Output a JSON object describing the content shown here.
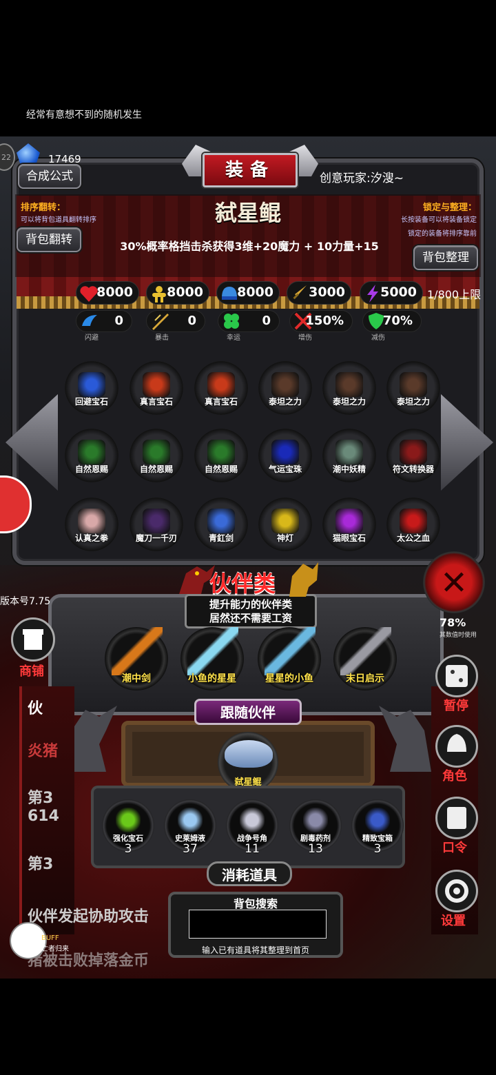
{
  "top_hint": "经常有意想不到的随机发生",
  "header": {
    "level_badge": "22",
    "gem_count": "17469",
    "title": "装备",
    "formula_button": "合成公式",
    "player_name": "创意玩家:汐溲~"
  },
  "sort_flip": {
    "title": "排序翻转：",
    "desc": "可以将背包道具翻转排序",
    "button": "背包翻转"
  },
  "lock_sort": {
    "title": "锁定与整理：",
    "desc1": "长按装备可以将装备锁定",
    "desc2": "锁定的装备将排序靠前",
    "button": "背包整理"
  },
  "selected_item": {
    "name": "弑星鲲",
    "desc": "30%概率格挡击杀获得3维+20魔力 + 10力量+15"
  },
  "stats": {
    "hp": "8000",
    "str": "8000",
    "def": "8000",
    "atk": "3000",
    "magic": "5000",
    "cap": "1/800上限"
  },
  "sub_stats": [
    {
      "label": "闪避",
      "value": "0",
      "icon": "wing-icon"
    },
    {
      "label": "暴击",
      "value": "0",
      "icon": "sword-slash-icon"
    },
    {
      "label": "幸运",
      "value": "0",
      "icon": "clover-icon"
    },
    {
      "label": "增伤",
      "value": "150%",
      "icon": "crossed-swords-icon"
    },
    {
      "label": "减伤",
      "value": "70%",
      "icon": "shield-icon"
    }
  ],
  "items": [
    {
      "name": "回避宝石",
      "color": "#2a5ad8"
    },
    {
      "name": "真言宝石",
      "color": "#c83a1a"
    },
    {
      "name": "真言宝石",
      "color": "#c83a1a"
    },
    {
      "name": "泰坦之力",
      "color": "#5a3a2a"
    },
    {
      "name": "泰坦之力",
      "color": "#5a3a2a"
    },
    {
      "name": "泰坦之力",
      "color": "#5a3a2a"
    },
    {
      "name": "自然恩赐",
      "color": "#2a7a2a"
    },
    {
      "name": "自然恩赐",
      "color": "#2a7a2a"
    },
    {
      "name": "自然恩赐",
      "color": "#2a7a2a"
    },
    {
      "name": "气运宝珠",
      "color": "#1a2ab8"
    },
    {
      "name": "潮中妖精",
      "color": "#6a8a7a"
    },
    {
      "name": "符文转换器",
      "color": "#8a1a1a"
    },
    {
      "name": "认真之拳",
      "color": "#d8a8a8"
    },
    {
      "name": "魔刀一千刃",
      "color": "#4a2a6a"
    },
    {
      "name": "青釭剑",
      "color": "#3a6ad8"
    },
    {
      "name": "神灯",
      "color": "#d8b81a"
    },
    {
      "name": "猫眼宝石",
      "color": "#a82ad8"
    },
    {
      "name": "太公之血",
      "color": "#c81a1a"
    }
  ],
  "partner": {
    "title": "伙伴类",
    "sub1": "提升能力的伙伴类",
    "sub2": "居然还不需要工资",
    "list": [
      {
        "name": "潮中剑",
        "color": "#d8781a"
      },
      {
        "name": "小鱼的星星",
        "color": "#8ad8f0"
      },
      {
        "name": "星星的小鱼",
        "color": "#6ab8e0"
      },
      {
        "name": "末日启示",
        "color": "#9a9aa2"
      }
    ],
    "follow_label": "跟随伙伴",
    "follow_name": "弑星鲲"
  },
  "consumables": {
    "label": "消耗道具",
    "list": [
      {
        "name": "强化宝石",
        "count": "3",
        "color": "#6ac81a"
      },
      {
        "name": "史莱姆液",
        "count": "37",
        "color": "#9ac8f0"
      },
      {
        "name": "战争号角",
        "count": "11",
        "color": "#c8c8d8"
      },
      {
        "name": "剧毒药剂",
        "count": "13",
        "color": "#8a8aa8"
      },
      {
        "name": "精致宝箱",
        "count": "3",
        "color": "#3a5ac8"
      }
    ]
  },
  "search": {
    "title": "背包搜索",
    "value": "",
    "hint": "输入已有道具将其整理到首页"
  },
  "left": {
    "version": "版本号7.75",
    "shop": "商铺",
    "log1": "伙",
    "log2": "炎猪",
    "log3": "第3",
    "log4": "614",
    "log5": "第3",
    "log6": "伙伴发起协助攻击",
    "log7": "猪被击败掉落金币",
    "buff": "BUFF",
    "buff_sub": "亡者归来"
  },
  "right": {
    "num": "78%",
    "num_sub": "其数值时使用",
    "pause": "暂停",
    "role": "角色",
    "code": "口令",
    "settings": "设置"
  }
}
